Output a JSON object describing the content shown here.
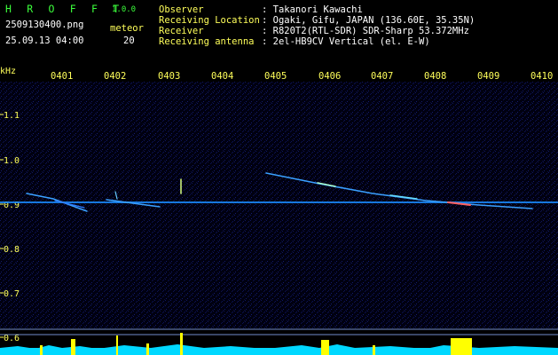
{
  "app": {
    "name": "H R O F F T",
    "version": "1.0.0"
  },
  "file": {
    "filename": "2509130400.png",
    "datetime": "25.09.13 04:00",
    "meteor_label": "meteor",
    "meteor_count": "20"
  },
  "info": {
    "observer_key": "Observer",
    "observer_val": ": Takanori Kawachi",
    "location_key": "Receiving Location",
    "location_val": ": Ogaki, Gifu, JAPAN (136.60E, 35.35N)",
    "receiver_key": "Receiver",
    "receiver_val": ": R820T2(RTL-SDR) SDR-Sharp 53.372MHz",
    "antenna_key": "Receiving antenna",
    "antenna_val": ": 2el-HB9CV Vertical (el. E-W)"
  },
  "axis": {
    "unit": "kHz",
    "x_ticks": [
      "0401",
      "0402",
      "0403",
      "0404",
      "0405",
      "0406",
      "0407",
      "0408",
      "0409",
      "0410"
    ],
    "y_ticks": [
      "1.1",
      "1.0",
      "0.9",
      "0.8",
      "0.7",
      "0.6"
    ]
  },
  "colors": {
    "brand": "#3cff3c",
    "label": "#ffff5a",
    "text": "#ffffff",
    "background": "#000000",
    "carrier": "#00ccff",
    "level": "#00e5ff",
    "level_peak": "#ffff00"
  }
}
